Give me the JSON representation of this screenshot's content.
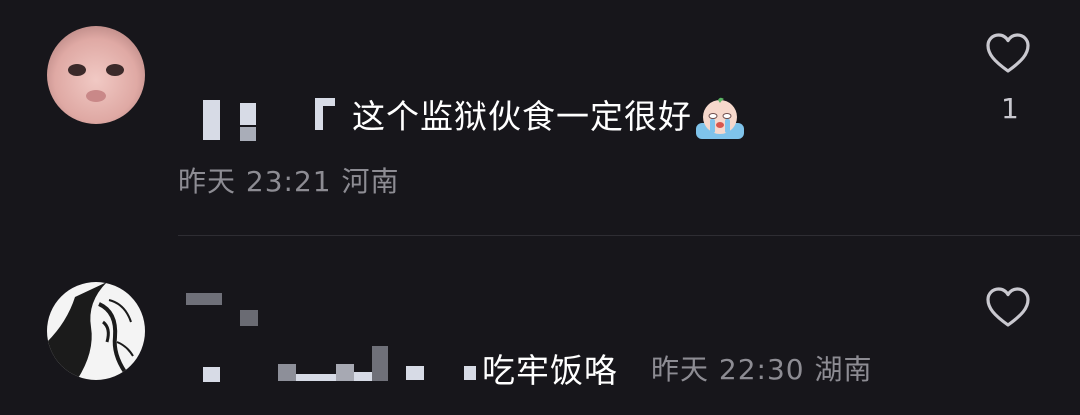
{
  "comments": [
    {
      "text": "这个监狱伙食一定很好",
      "emoji_icon": "crying-face-emoji",
      "time": "昨天 23:21",
      "location": "河南",
      "likes": "1"
    },
    {
      "text": "吃牢饭咯",
      "time": "昨天 22:30",
      "location": "湖南",
      "likes": ""
    }
  ],
  "icons": {
    "like": "heart-outline-icon"
  },
  "colors": {
    "background": "#17161b",
    "text": "#ffffff",
    "meta": "#8d8c93",
    "mosaic": "#d7dbe6"
  }
}
